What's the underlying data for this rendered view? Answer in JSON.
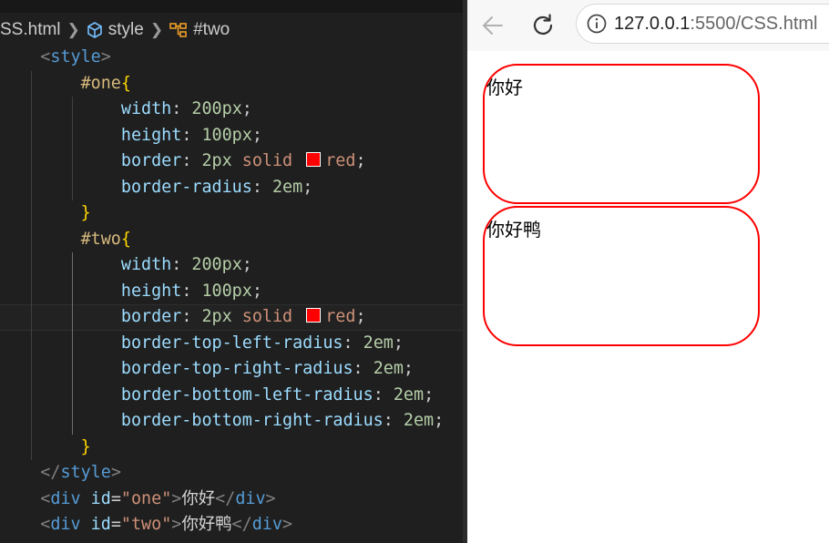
{
  "breadcrumb": {
    "file": "SS.html",
    "style": "style",
    "selector": "#two"
  },
  "code": {
    "style_open": "style",
    "rule_one": {
      "selector": "#one",
      "decls": [
        {
          "prop": "width",
          "num": "200px",
          "val": ""
        },
        {
          "prop": "height",
          "num": "100px",
          "val": ""
        },
        {
          "prop": "border",
          "num": "2px",
          "val": "solid",
          "color": "red"
        },
        {
          "prop": "border-radius",
          "num": "2em",
          "val": ""
        }
      ]
    },
    "rule_two": {
      "selector": "#two",
      "decls": [
        {
          "prop": "width",
          "num": "200px"
        },
        {
          "prop": "height",
          "num": "100px"
        },
        {
          "prop": "border",
          "num": "2px",
          "val": "solid",
          "color": "red"
        },
        {
          "prop": "border-top-left-radius",
          "num": "2em"
        },
        {
          "prop": "border-top-right-radius",
          "num": "2em"
        },
        {
          "prop": "border-bottom-left-radius",
          "num": "2em"
        },
        {
          "prop": "border-bottom-right-radius",
          "num": "2em"
        }
      ]
    },
    "style_close": "style",
    "div_one": {
      "tag": "div",
      "attr": "id",
      "value": "\"one\"",
      "text": "你好"
    },
    "div_two": {
      "tag": "div",
      "attr": "id",
      "value": "\"two\"",
      "text": "你好鸭"
    }
  },
  "browser": {
    "url_host": "127.0.0.1",
    "url_rest": ":5500/CSS.html",
    "box_one_text": "你好",
    "box_two_text": "你好鸭"
  },
  "colors": {
    "editor_bg": "#1f1f1f",
    "border_red": "#ff0000",
    "tag_blue": "#569cd6",
    "selector_gold": "#d7ba7d",
    "property_cyan": "#9cdcfe",
    "number_green": "#b5cea8",
    "string_orange": "#ce9178"
  },
  "icons": [
    "cube-icon",
    "symbol-class-icon",
    "back-arrow-icon",
    "reload-icon",
    "info-icon",
    "color-swatch-icon"
  ]
}
